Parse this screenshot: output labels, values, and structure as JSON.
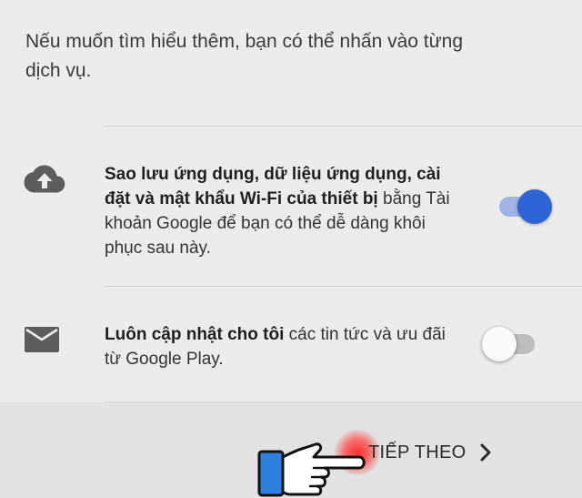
{
  "intro": {
    "line1": "Nếu muốn tìm hiểu thêm, bạn có thể nhấn vào từng",
    "line2": "dịch vụ."
  },
  "backup": {
    "icon": "cloud-upload-icon",
    "bold_line1": "Sao lưu ứng dụng, dữ liệu ứng dụng, cài",
    "bold_line2": "đặt và mật khẩu Wi-Fi của thiết bị",
    "rest_line2": " bằng Tài",
    "line3": "khoản Google để bạn có thể dễ dàng khôi",
    "line4": "phục sau này.",
    "toggle_on": true
  },
  "updates": {
    "icon": "mail-icon",
    "bold": "Luôn cập nhật cho tôi",
    "rest_line1": " các tin tức và ưu đãi",
    "line2": "từ Google Play.",
    "toggle_on": false
  },
  "footer": {
    "next_label": "TIẾP THEO",
    "chevron_icon": "chevron-right-icon",
    "pointer_icon": "pointing-hand-icon"
  },
  "colors": {
    "background": "#ececec",
    "footer_background": "#e2e2e2",
    "toggle_on_thumb": "#2f64d6",
    "toggle_on_track": "#9fb3e6",
    "toggle_off_track": "#bdbdbd",
    "tap_highlight": "#ff2828"
  }
}
